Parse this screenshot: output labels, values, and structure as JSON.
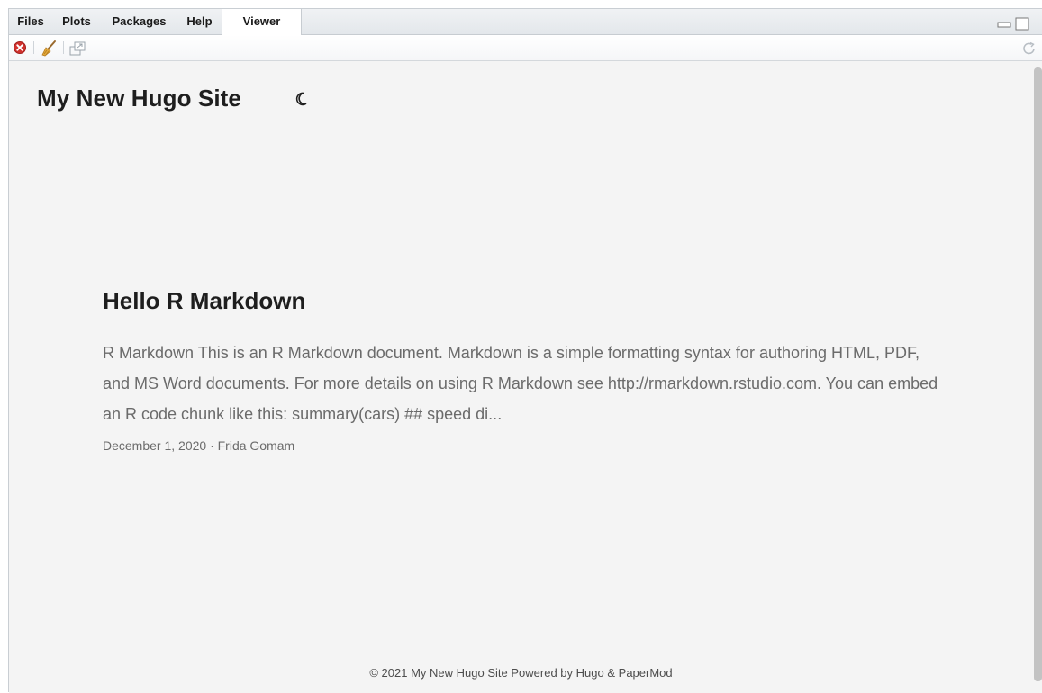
{
  "tabs": [
    {
      "label": "Files",
      "active": false
    },
    {
      "label": "Plots",
      "active": false
    },
    {
      "label": "Packages",
      "active": false
    },
    {
      "label": "Help",
      "active": false
    },
    {
      "label": "Viewer",
      "active": true
    }
  ],
  "toolbar": {
    "icons": [
      "stop-icon",
      "broom-icon",
      "popout-icon",
      "refresh-icon"
    ]
  },
  "site": {
    "title": "My New Hugo Site",
    "theme_toggle_icon": "moon-icon"
  },
  "post": {
    "title": "Hello R Markdown",
    "summary": "R Markdown This is an R Markdown document. Markdown is a simple formatting syntax for authoring HTML, PDF, and MS Word documents. For more details on using R Markdown see http://rmarkdown.rstudio.com. You can embed an R code chunk like this: summary(cars) ## speed di...",
    "meta": "December 1, 2020 · Frida Gomam"
  },
  "footer": {
    "copyright": "© 2021",
    "site_link": "My New Hugo Site",
    "powered_by": "Powered by",
    "hugo_link": "Hugo",
    "ampersand": "&",
    "papermod_link": "PaperMod"
  },
  "colors": {
    "background": "#f4f4f4",
    "heading": "#1e1e1e",
    "muted_text": "#6b6b6b",
    "stop_red": "#d0312d"
  }
}
